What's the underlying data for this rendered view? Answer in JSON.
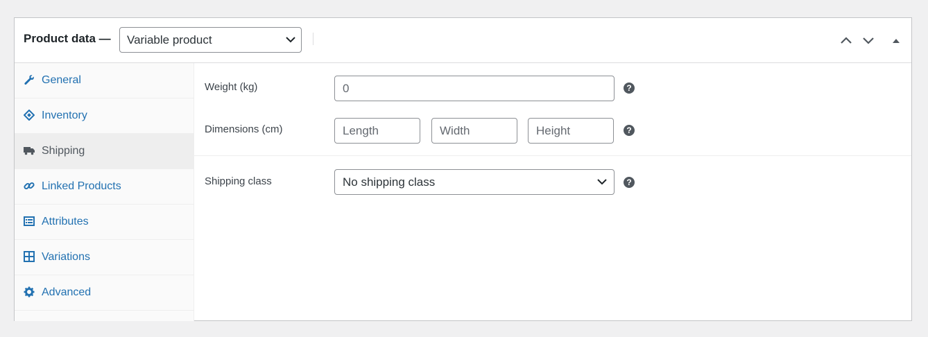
{
  "header": {
    "title": "Product data —",
    "product_type": "Variable product",
    "controls": {
      "move_up": "chevron-up-icon",
      "move_down": "chevron-down-icon",
      "toggle": "triangle-up-icon"
    }
  },
  "tabs": [
    {
      "label": "General",
      "icon": "wrench-icon",
      "active": false
    },
    {
      "label": "Inventory",
      "icon": "tag-icon",
      "active": false
    },
    {
      "label": "Shipping",
      "icon": "truck-icon",
      "active": true
    },
    {
      "label": "Linked Products",
      "icon": "link-icon",
      "active": false
    },
    {
      "label": "Attributes",
      "icon": "list-card-icon",
      "active": false
    },
    {
      "label": "Variations",
      "icon": "grid-icon",
      "active": false
    },
    {
      "label": "Advanced",
      "icon": "gear-icon",
      "active": false
    }
  ],
  "shipping": {
    "weight_label": "Weight (kg)",
    "weight_value": "",
    "weight_placeholder": "0",
    "dimensions_label": "Dimensions (cm)",
    "length_placeholder": "Length",
    "width_placeholder": "Width",
    "height_placeholder": "Height",
    "class_label": "Shipping class",
    "class_value": "No shipping class",
    "help_glyph": "?"
  },
  "colors": {
    "link": "#2271b1",
    "active_tab_bg": "#eeeeee",
    "border": "#c3c4c7"
  }
}
